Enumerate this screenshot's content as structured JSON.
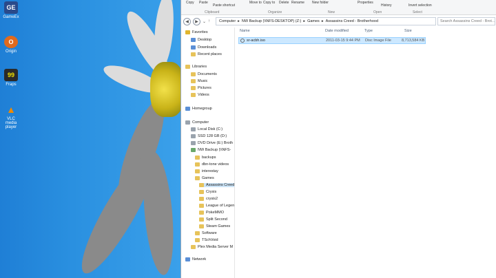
{
  "desktop": {
    "icons": [
      {
        "label": "GameEx",
        "color": "#2a4a8a",
        "glyph": "GE"
      },
      {
        "label": "Origin",
        "color": "#e06a1e",
        "glyph": "O"
      },
      {
        "label": "Fraps",
        "color": "#2a2a2a",
        "glyph": "99"
      },
      {
        "label": "VLC media player",
        "color": "#f08a00",
        "glyph": "▲"
      }
    ]
  },
  "ribbon": {
    "buttons": [
      "Copy",
      "Paste",
      "Paste shortcut",
      "Move to",
      "Copy to",
      "Delete",
      "Rename",
      "New folder",
      "Properties",
      "History",
      "Invert selection"
    ],
    "groups": [
      "Clipboard",
      "Organize",
      "New",
      "Open",
      "Select"
    ]
  },
  "address": {
    "crumbs": [
      "Computer",
      "NW Backup (\\\\NFS-DESKTOP) (Z:)",
      "Games",
      "Assassins Creed - Brotherhood"
    ],
    "search_placeholder": "Search Assassins Creed - Brot..."
  },
  "nav": {
    "items": [
      {
        "label": "Favorites",
        "icon": "star"
      },
      {
        "label": "Desktop",
        "icon": "blue"
      },
      {
        "label": "Downloads",
        "icon": "blue"
      },
      {
        "label": "Recent places",
        "icon": "fold"
      },
      {
        "label": "Libraries",
        "icon": "fold"
      },
      {
        "label": "Documents",
        "icon": "fold"
      },
      {
        "label": "Music",
        "icon": "fold"
      },
      {
        "label": "Pictures",
        "icon": "fold"
      },
      {
        "label": "Videos",
        "icon": "fold"
      },
      {
        "label": "Homegroup",
        "icon": "blue"
      },
      {
        "label": "Computer",
        "icon": "drv"
      },
      {
        "label": "Local Disk (C:)",
        "icon": "drv"
      },
      {
        "label": "SSD 128 GB (D:)",
        "icon": "drv"
      },
      {
        "label": "DVD Drive (E:) Broth",
        "icon": "drv"
      },
      {
        "label": "NW Backup (\\\\NFS-",
        "icon": "green"
      },
      {
        "label": "backups",
        "icon": "fold"
      },
      {
        "label": "dbn-tone videos",
        "icon": "fold"
      },
      {
        "label": "interestay",
        "icon": "fold"
      },
      {
        "label": "Games",
        "icon": "fold"
      },
      {
        "label": "Assassins Creed",
        "icon": "fold"
      },
      {
        "label": "Crysis",
        "icon": "fold"
      },
      {
        "label": "crysis2",
        "icon": "fold"
      },
      {
        "label": "League of Legen",
        "icon": "fold"
      },
      {
        "label": "PokeMMO",
        "icon": "fold"
      },
      {
        "label": "Split Second",
        "icon": "fold"
      },
      {
        "label": "Steam Games",
        "icon": "fold"
      },
      {
        "label": "Software",
        "icon": "fold"
      },
      {
        "label": "TSchVoid",
        "icon": "fold"
      },
      {
        "label": "Plex Media Server M",
        "icon": "fold"
      },
      {
        "label": "Network",
        "icon": "blue"
      }
    ]
  },
  "columns": [
    "Name",
    "Date modified",
    "Type",
    "Size"
  ],
  "files": [
    {
      "name": "sr-acbh.iso",
      "date": "2011-03-15 9:44 PM",
      "type": "Disc Image File",
      "size": "8,713,584 KB"
    }
  ]
}
